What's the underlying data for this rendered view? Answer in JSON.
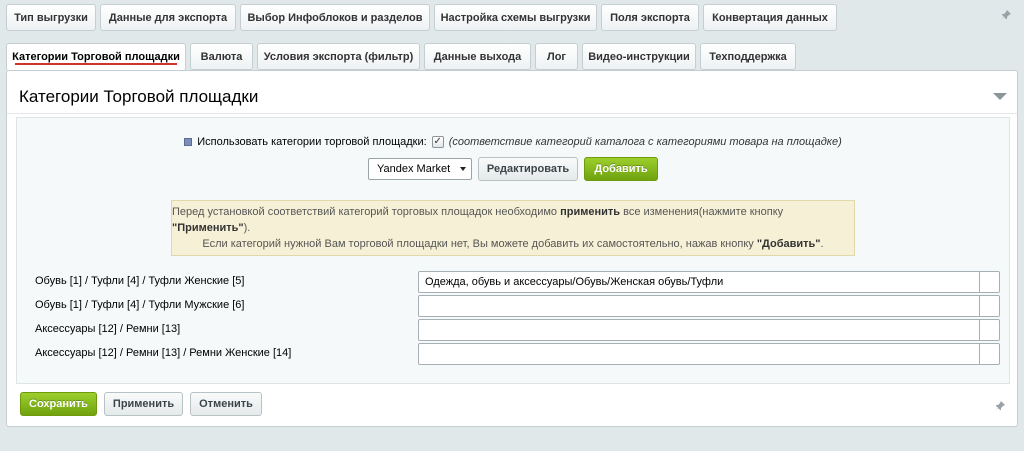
{
  "tabs_row1": [
    {
      "label": "Тип выгрузки"
    },
    {
      "label": "Данные для экспорта"
    },
    {
      "label": "Выбор Инфоблоков и разделов"
    },
    {
      "label": "Настройка схемы выгрузки"
    },
    {
      "label": "Поля экспорта"
    },
    {
      "label": "Конвертация данных"
    }
  ],
  "tabs_row2": [
    {
      "label": "Категории Торговой площадки",
      "active": true
    },
    {
      "label": "Валюта"
    },
    {
      "label": "Условия экспорта (фильтр)"
    },
    {
      "label": "Данные выхода"
    },
    {
      "label": "Лог"
    },
    {
      "label": "Видео-инструкции"
    },
    {
      "label": "Техподдержка"
    }
  ],
  "panel": {
    "title": "Категории Торговой площадки"
  },
  "settings": {
    "use_label": "Использовать категории торговой площадки:",
    "use_checked": true,
    "use_checkmark": "✓",
    "use_note": "(соответствие категорий каталога с категориями товара на площадке)",
    "marketplace_selected": "Yandex Market",
    "edit_button": "Редактировать",
    "add_button": "Добавить"
  },
  "notice": {
    "line1_prefix": "Перед установкой соответствий категорий торговых площадок необходимо ",
    "line1_bold": "применить",
    "line1_middle": " все изменения(нажмите кнопку ",
    "line1_bold2": "\"Применить\"",
    "line1_suffix": ").",
    "line2_prefix": "Если категорий нужной Вам торговой площадки нет, Вы можете добавить их самостоятельно, нажав кнопку ",
    "line2_bold": "\"Добавить\"",
    "line2_suffix": "."
  },
  "categories": [
    {
      "label": "Обувь [1] / Туфли [4] / Туфли Женские [5]",
      "value": "Одежда, обувь и аксессуары/Обувь/Женская обувь/Туфли"
    },
    {
      "label": "Обувь [1] / Туфли [4] / Туфли Мужские [6]",
      "value": ""
    },
    {
      "label": "Аксессуары [12] / Ремни [13]",
      "value": ""
    },
    {
      "label": "Аксессуары [12] / Ремни [13] / Ремни Женские [14]",
      "value": ""
    }
  ],
  "footer": {
    "save_button": "Сохранить",
    "apply_button": "Применить",
    "cancel_button": "Отменить"
  },
  "icons": {
    "pin": "pin-icon",
    "collapse": "chevron-down-icon",
    "select_arrow": "chevron-down-icon"
  },
  "colors": {
    "accent_green": "#7ab51d",
    "active_tab_underline": "#d0342c",
    "notice_bg": "#f6f1d6"
  }
}
